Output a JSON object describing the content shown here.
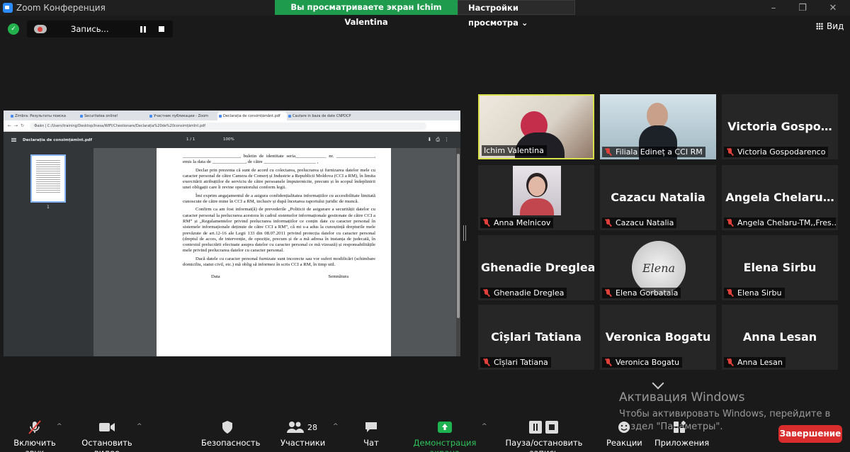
{
  "window": {
    "title": "Zoom Конференция",
    "viewing_banner": "Вы просматриваете экран Ichim Valentina",
    "view_options": "Настройки просмотра ⌄"
  },
  "recording": {
    "label": "Запись..."
  },
  "view_button": {
    "label": "Вид"
  },
  "shared_screen": {
    "browser_tabs": [
      "Zimbra: Результаты поиска",
      "Securitatea online!",
      "Участник публикации - Zoom",
      "Declarația de consimțământ.pdf",
      "Cautare in baza de date CNPDCP"
    ],
    "address": "Файл | C:/Users/training/Desktop/Inesa/WIFI/Chestionare/Declarația%20de%20consimțămînt.pdf",
    "pdf_filename": "Declarația de consimțămînt.pdf",
    "pdf_pages": "1 / 1",
    "pdf_zoom": "100%",
    "thumb_page": "1",
    "document": {
      "line1": "________________________, buletin de identitate seria_____________ nr. ________________, emis la data de ______________, de către ______________________ ,",
      "p1": "Declar prin prezenta că sunt de acord cu colectarea, prelucrarea și furnizarea datelor mele cu caracter personal de către Camera de Comerț și Industrie a Republicii Moldova (CCI a RM), în limita exercitării atribuțiilor de serviciu de către persoanele împuternicite, precum și în scopul îndeplinirii unei obligații care îi revine operatorului conform legii.",
      "p2": "Îmi exprim angajamentul de a asigura confidențialitatea informațiilor cu accesibilitate limitată cunoscute de către mine în CCI a RM, inclusiv și după încetarea raportului juridic de muncă.",
      "p3": "Confirm ca am fost informat(ă) de prevederile „Politicii de asigurare a securității datelor cu caracter personal la prelucrarea acestora în cadrul sistemelor informaționale gestionate de către CCI a RM” și „Regulamentelor privind prelucrarea informațiilor ce conțin date cu caracter personal în sistemele informaționale deținute de către CCI a RM”, că mi s-a adus la cunoștință drepturile mele prevăzute de art.12-16 ale Legii 133 din 08.07.2011 privind protecția datelor cu caracter personal (dreptul de acces, de intervenție, de opoziție, precum și de a mă adresa în instanța de judecată, în contextul prelucrării efectuate asupra datelor cu caracter personal ce mă vizează) și responsabilitățile mele privind prelucrarea datelor cu caracter personal.",
      "p4": "Dacă datele cu caracter personal furnizate sunt incorecte sau vor suferi modificări (schimbare domiciliu, statut civil, etc.) mă oblig să informez în scris CCI a RM, în timp util.",
      "date_label": "Data",
      "signature_label": "Semnătura"
    }
  },
  "participants": [
    {
      "big": "",
      "tag": "Ichim Valentina",
      "muted": false,
      "active": true
    },
    {
      "big": "",
      "tag": "Filiala Edineț a CCI RM",
      "muted": true
    },
    {
      "big": "Victoria Gospo…",
      "tag": "Victoria Gospodarenco",
      "muted": true
    },
    {
      "big": "",
      "tag": "Anna Melnicov",
      "muted": true
    },
    {
      "big": "Cazacu Natalia",
      "tag": "Cazacu Natalia",
      "muted": true
    },
    {
      "big": "Angela Chelaru…",
      "tag": "Angela Chelaru-TM,,Fres…",
      "muted": true
    },
    {
      "big": "Ghenadie Dreglea",
      "tag": "Ghenadie Dreglea",
      "muted": true
    },
    {
      "big": "",
      "tag": "Elena Gorbataia",
      "muted": true,
      "avatar_text": "Elena"
    },
    {
      "big": "Elena Sirbu",
      "tag": "Elena Sirbu",
      "muted": true
    },
    {
      "big": "Cîșlari Tatiana",
      "tag": "Cîșlari Tatiana",
      "muted": true
    },
    {
      "big": "Veronica Bogatu",
      "tag": "Veronica Bogatu",
      "muted": true
    },
    {
      "big": "Anna Lesan",
      "tag": "Anna Lesan",
      "muted": true
    }
  ],
  "activation": {
    "title": "Активация Windows",
    "line1": "Чтобы активировать Windows, перейдите в",
    "line2": "раздел \"Параметры\"."
  },
  "toolbar": {
    "unmute": "Включить звук",
    "start_video": "Остановить видео",
    "security": "Безопасность",
    "participants": "Участники",
    "participants_count": "28",
    "chat": "Чат",
    "share_screen": "Демонстрация экрана",
    "pause_recording": "Пауза/остановить запись",
    "reactions": "Реакции",
    "apps": "Приложения",
    "end": "Завершение"
  },
  "colors": {
    "accent_green": "#1e9b4d",
    "end_red": "#d92d2d",
    "active_speaker": "#d8e14a",
    "muted_red": "#e0403a"
  }
}
